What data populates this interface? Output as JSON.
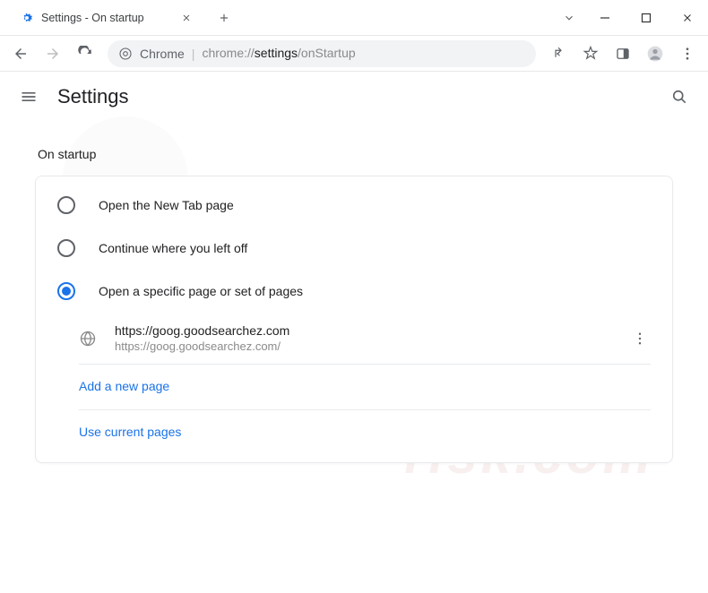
{
  "titlebar": {
    "tab_title": "Settings - On startup"
  },
  "toolbar": {
    "prefix": "Chrome",
    "url_dim": "chrome://",
    "url_mid": "settings",
    "url_end": "/onStartup"
  },
  "header": {
    "title": "Settings"
  },
  "section": {
    "label": "On startup",
    "options": [
      {
        "label": "Open the New Tab page",
        "selected": false
      },
      {
        "label": "Continue where you left off",
        "selected": false
      },
      {
        "label": "Open a specific page or set of pages",
        "selected": true
      }
    ],
    "startup_page": {
      "name": "https://goog.goodsearchez.com",
      "url": "https://goog.goodsearchez.com/"
    },
    "add_page_label": "Add a new page",
    "use_current_label": "Use current pages"
  }
}
